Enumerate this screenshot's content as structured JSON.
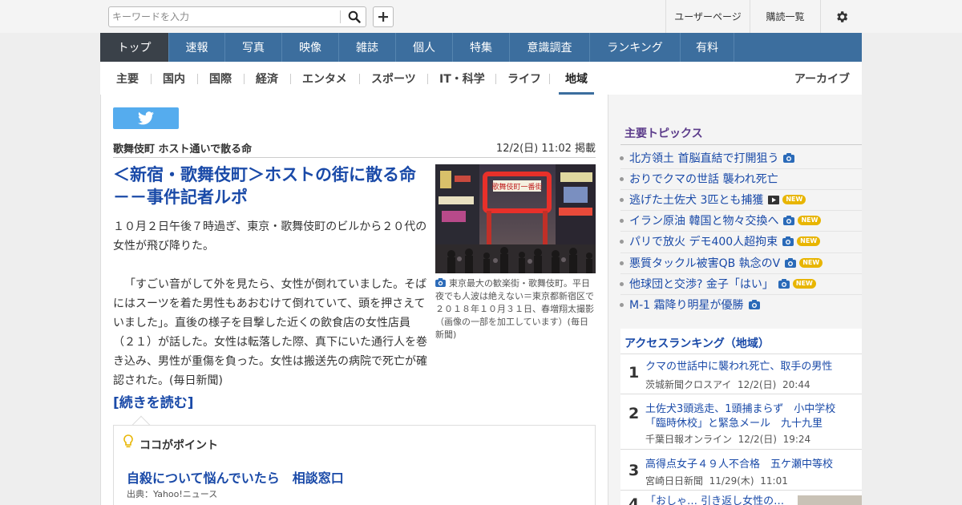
{
  "search": {
    "placeholder": "キーワードを入力",
    "button_icon": "search-icon"
  },
  "topbar": {
    "add_icon": "plus-icon",
    "user_page": "ユーザーページ",
    "subscriptions": "購読一覧",
    "settings_icon": "gear-icon"
  },
  "main_nav": [
    "トップ",
    "速報",
    "写真",
    "映像",
    "雑誌",
    "個人",
    "特集",
    "意識調査",
    "ランキング",
    "有料"
  ],
  "main_nav_active": "トップ",
  "sub_nav": [
    "主要",
    "国内",
    "国際",
    "経済",
    "エンタメ",
    "スポーツ",
    "IT・科学",
    "ライフ",
    "地域"
  ],
  "sub_nav_active": "地域",
  "archive": "アーカイブ",
  "article": {
    "share_icon": "twitter-icon",
    "category": "歌舞伎町 ホスト通いで散る命",
    "date": "12/2(日) 11:02 掲載",
    "title": "＜新宿・歌舞伎町＞ホストの街に散る命－－事件記者ルポ",
    "body_1": "１０月２日午後７時過ぎ、東京・歌舞伎町のビルから２０代の女性が飛び降りた。",
    "body_2": "「すごい音がして外を見たら、女性が倒れていました。そばにはスーツを着た男性もあおむけて倒れていて、頭を押さえていました」。直後の様子を目撃した近くの飲食店の女性店員（２１）が話した。女性は転落した際、真下にいた通行人を巻き込み、男性が重傷を負った。女性は搬送先の病院で死亡が確認された。(毎日新聞)",
    "read_more": "[続きを読む]",
    "photo_caption": "東京最大の歓楽街・歌舞伎町。平日夜でも人波は絶えない＝東京都新宿区で２０１８年１０月３１日、春増翔太撮影（画像の一部を加工しています）(毎日新聞)",
    "photo_sign": "歌舞伎町一番街"
  },
  "point": {
    "title": "ココがポイント",
    "link": "自殺について悩んでいたら　相談窓口",
    "source": "出典：Yahoo!ニュース"
  },
  "topics": {
    "title": "主要トピックス",
    "items": [
      {
        "text": "北方領土 首脳直結で打開狙う",
        "icon": "camera-icon",
        "new": false
      },
      {
        "text": "おりでクマの世話 襲われ死亡",
        "icon": "",
        "new": false
      },
      {
        "text": "逃げた土佐犬 3匹とも捕獲",
        "icon": "video-icon",
        "new": true
      },
      {
        "text": "イラン原油 韓国と物々交換へ",
        "icon": "camera-icon",
        "new": true
      },
      {
        "text": "パリで放火 デモ400人超拘束",
        "icon": "camera-icon",
        "new": true
      },
      {
        "text": "悪質タックル被害QB 執念のV",
        "icon": "camera-icon",
        "new": true
      },
      {
        "text": "他球団と交渉? 金子「はい」",
        "icon": "camera-icon",
        "new": true
      },
      {
        "text": "M-1 霜降り明星が優勝",
        "icon": "camera-icon",
        "new": false
      }
    ],
    "new_label": "NEW"
  },
  "ranking": {
    "title": "アクセスランキング（地域）",
    "items": [
      {
        "rank": "1",
        "title": "クマの世話中に襲われ死亡、取手の男性",
        "source": "茨城新聞クロスアイ",
        "date": "12/2(日)",
        "time": "20:44"
      },
      {
        "rank": "2",
        "title": "土佐犬3頭逃走、1頭捕まらず　小中学校「臨時休校」と緊急メール　九十九里",
        "source": "千葉日報オンライン",
        "date": "12/2(日)",
        "time": "19:24"
      },
      {
        "rank": "3",
        "title": "高得点女子４９人不合格　五ケ瀬中等校",
        "source": "宮崎日日新聞",
        "date": "11/29(木)",
        "time": "11:01"
      },
      {
        "rank": "4",
        "title": "「おしゃ… 引き返し女性の…",
        "source": "",
        "date": "",
        "time": ""
      }
    ]
  },
  "colors": {
    "nav": "#3c6e9e",
    "nav_active": "#3a4149",
    "link": "#1a4aa8",
    "topics_title": "#5b3b8a",
    "new_badge": "#e8b500",
    "twitter": "#55acee"
  }
}
